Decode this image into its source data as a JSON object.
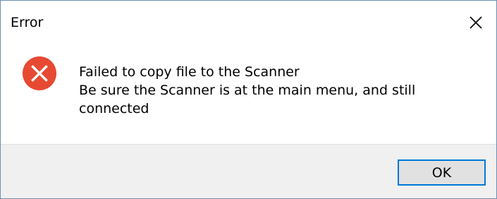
{
  "window": {
    "title": "Error",
    "close_icon": "close-icon"
  },
  "message": {
    "icon": "error-icon",
    "line1": "Failed to copy file to the Scanner",
    "line2": "Be sure the Scanner is at the main menu, and still",
    "line3": "connected"
  },
  "buttons": {
    "ok_label": "OK"
  },
  "colors": {
    "error_red": "#e81123",
    "accent_blue": "#0078d7",
    "footer_bg": "#f0f0f0"
  }
}
